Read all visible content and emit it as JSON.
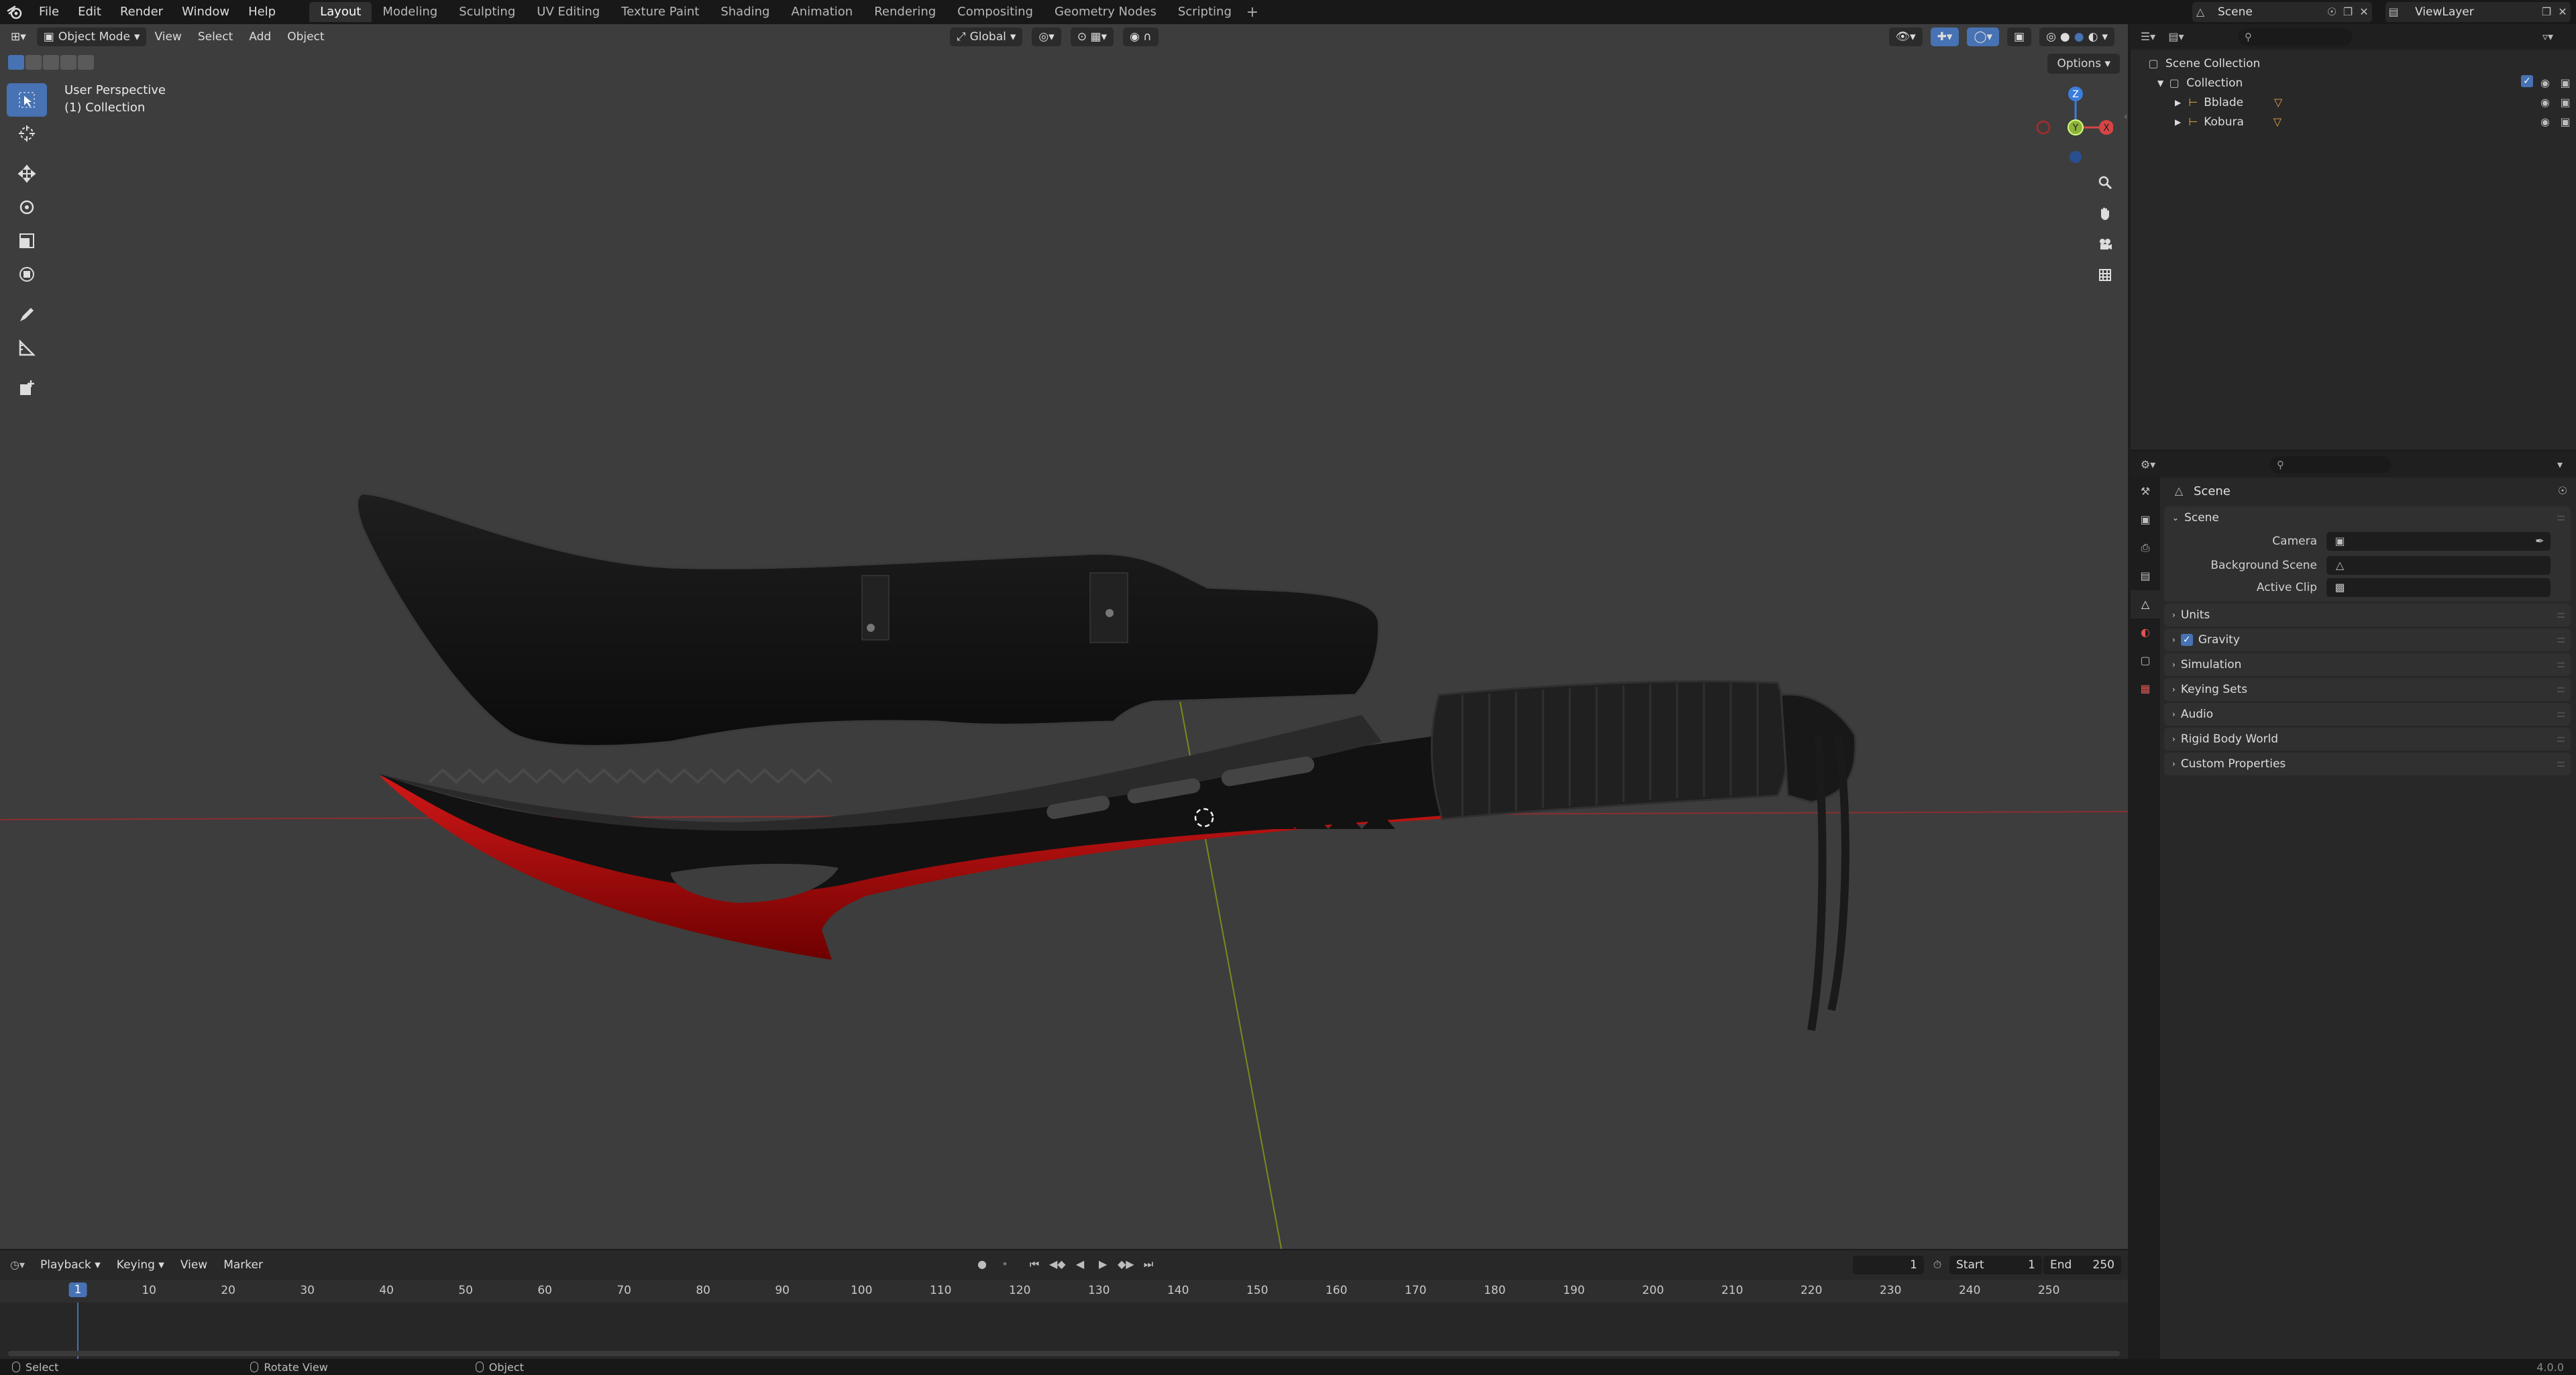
{
  "menu": {
    "file": "File",
    "edit": "Edit",
    "render": "Render",
    "window": "Window",
    "help": "Help"
  },
  "workspaces": [
    "Layout",
    "Modeling",
    "Sculpting",
    "UV Editing",
    "Texture Paint",
    "Shading",
    "Animation",
    "Rendering",
    "Compositing",
    "Geometry Nodes",
    "Scripting"
  ],
  "top_right": {
    "scene": "Scene",
    "view_layer": "ViewLayer"
  },
  "viewport": {
    "mode": "Object Mode",
    "menus": [
      "View",
      "Select",
      "Add",
      "Object"
    ],
    "orientation": "Global",
    "perspective_label": "User Perspective",
    "collection_label": "(1) Collection",
    "options": "Options",
    "gizmo": {
      "x": "X",
      "y": "Y",
      "z": "Z"
    }
  },
  "outliner": {
    "root": "Scene Collection",
    "collection": "Collection",
    "objects": [
      "Bblade",
      "Kobura"
    ]
  },
  "properties": {
    "title": "Scene",
    "section": "Scene",
    "fields": {
      "camera": "Camera",
      "background_scene": "Background Scene",
      "active_clip": "Active Clip"
    },
    "panels": [
      "Units",
      "Gravity",
      "Simulation",
      "Keying Sets",
      "Audio",
      "Rigid Body World",
      "Custom Properties"
    ]
  },
  "timeline": {
    "menus": [
      "Playback",
      "Keying",
      "View",
      "Marker"
    ],
    "current_frame": "1",
    "start_label": "Start",
    "start": "1",
    "end_label": "End",
    "end": "250",
    "ticks": [
      "10",
      "20",
      "30",
      "40",
      "50",
      "60",
      "70",
      "80",
      "90",
      "100",
      "110",
      "120",
      "130",
      "140",
      "150",
      "160",
      "170",
      "180",
      "190",
      "200",
      "210",
      "220",
      "230",
      "240",
      "250"
    ]
  },
  "statusbar": {
    "select": "Select",
    "rotate": "Rotate View",
    "object": "Object",
    "version": "4.0.0"
  },
  "colors": {
    "accent": "#4772b3",
    "blade_red": "#b80d0d",
    "axis_x": "#d64545",
    "axis_y": "#8fb33c",
    "axis_z": "#3b7ddb"
  }
}
